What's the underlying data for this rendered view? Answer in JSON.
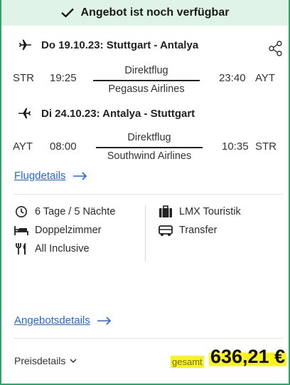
{
  "banner": {
    "text": "Angebot ist noch verfügbar"
  },
  "outbound": {
    "header": "Do 19.10.23: Stuttgart - Antalya",
    "from_code": "STR",
    "dep_time": "19:25",
    "type": "Direktflug",
    "airline": "Pegasus Airlines",
    "arr_time": "23:40",
    "to_code": "AYT"
  },
  "return": {
    "header": "Di 24.10.23: Antalya - Stuttgart",
    "from_code": "AYT",
    "dep_time": "08:00",
    "type": "Direktflug",
    "airline": "Southwind Airlines",
    "arr_time": "10:35",
    "to_code": "STR"
  },
  "links": {
    "flight_details": "Flugdetails",
    "offer_details": "Angebotsdetails"
  },
  "features": {
    "duration": "6 Tage / 5 Nächte",
    "room": "Doppelzimmer",
    "board": "All Inclusive",
    "operator": "LMX Touristik",
    "transfer": "Transfer"
  },
  "price": {
    "label": "Preisdetails",
    "total_label": "gesamt",
    "amount": "636,21 €"
  },
  "colors": {
    "accent_green": "#2fa567",
    "banner_bg": "#dff3e6",
    "link_blue": "#2563eb",
    "highlight": "#fbf31e"
  },
  "icons": [
    "check-icon",
    "plane-right-icon",
    "share-icon",
    "plane-left-icon",
    "arrow-right-icon",
    "clock-icon",
    "bed-icon",
    "cutlery-icon",
    "suitcase-icon",
    "bus-icon",
    "chevron-down-icon"
  ]
}
